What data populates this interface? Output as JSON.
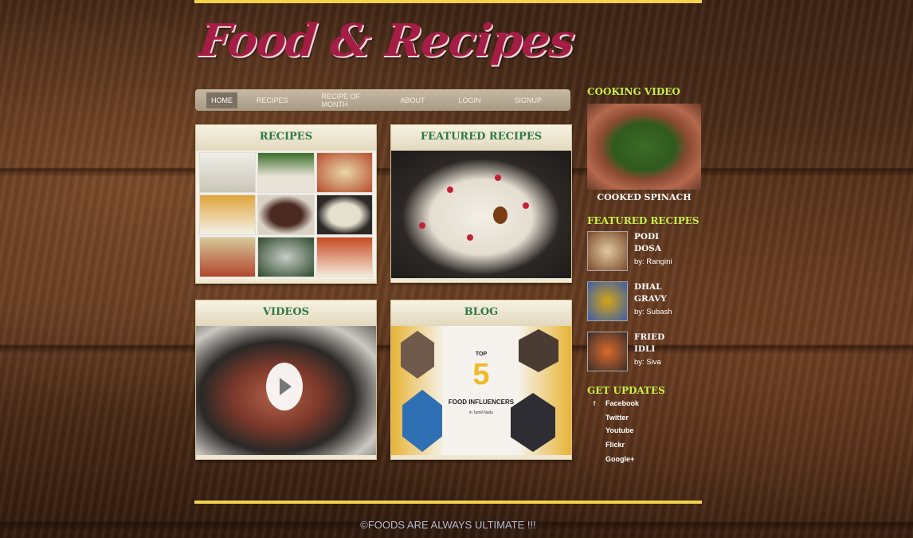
{
  "site": {
    "logo": "Food & Recipes"
  },
  "nav": {
    "items": [
      "HOME",
      "RECIPES",
      "RECIPE OF MONTH",
      "ABOUT",
      "LOGIN",
      "SIGNUP"
    ],
    "active": "HOME"
  },
  "panels": {
    "recipes": "RECIPES",
    "featured": "FEATURED RECIPES",
    "videos": "VIDEOS",
    "blog": "BLOG"
  },
  "blog_image": {
    "top": "TOP",
    "number": "5",
    "headline": "FOOD INFLUENCERS",
    "sub": "in Tamil Nadu"
  },
  "sidebar": {
    "video_title": "COOKING VIDEO",
    "video_caption": "COOKED SPINACH",
    "featured_title": "FEATURED RECIPES",
    "featured": [
      {
        "name_line1": "PODI",
        "name_line2": "DOSA",
        "by": "by: Rangini"
      },
      {
        "name_line1": "DHAL",
        "name_line2": "GRAVY",
        "by": "by: Subash"
      },
      {
        "name_line1": "FRIED",
        "name_line2": "IDLI",
        "by": "by: Siva"
      }
    ],
    "updates_title": "GET UPDATES",
    "social": [
      {
        "icon": "facebook-icon",
        "label": "Facebook",
        "glyph": "f"
      },
      {
        "icon": "twitter-icon",
        "label": "Twitter",
        "glyph": ""
      },
      {
        "icon": "youtube-icon",
        "label": "Youtube",
        "glyph": ""
      },
      {
        "icon": "flickr-icon",
        "label": "Flickr",
        "glyph": ""
      },
      {
        "icon": "google-plus-icon",
        "label": "Google+",
        "glyph": ""
      }
    ]
  },
  "footer": {
    "text": "©FOODS ARE ALWAYS ULTIMATE !!!"
  },
  "colors": {
    "accent_bar": "#f4d34b",
    "logo": "#a41d45",
    "panel_heading": "#2e7a45",
    "sidebar_heading": "#c8f04a"
  }
}
